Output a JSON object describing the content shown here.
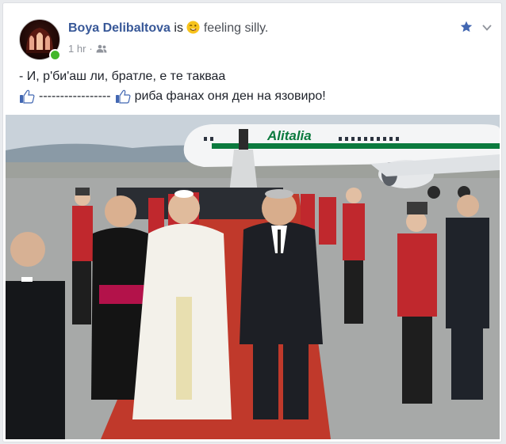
{
  "post": {
    "author": "Boya Delibaltova",
    "is_text": "is",
    "feeling_label": "feeling silly.",
    "timestamp": "1 hr",
    "separator": "·",
    "line1": "- И, р'би'аш ли, братле, е те такваа",
    "line2_middle": "-----------------",
    "line2_end": "риба фанах оня ден на язовиро!"
  },
  "photo": {
    "airline_logo_text": "Alitalia"
  },
  "colors": {
    "author_link": "#385898",
    "online": "#42b72a",
    "like_blue": "#4267b2",
    "carpet": "#c0392b",
    "guard_red": "#c0282d"
  },
  "icons": {
    "feeling": "winking-face-emoji",
    "audience": "friends-icon",
    "favorite": "star-icon",
    "menu": "chevron-down-icon",
    "like": "thumbs-up-icon"
  }
}
